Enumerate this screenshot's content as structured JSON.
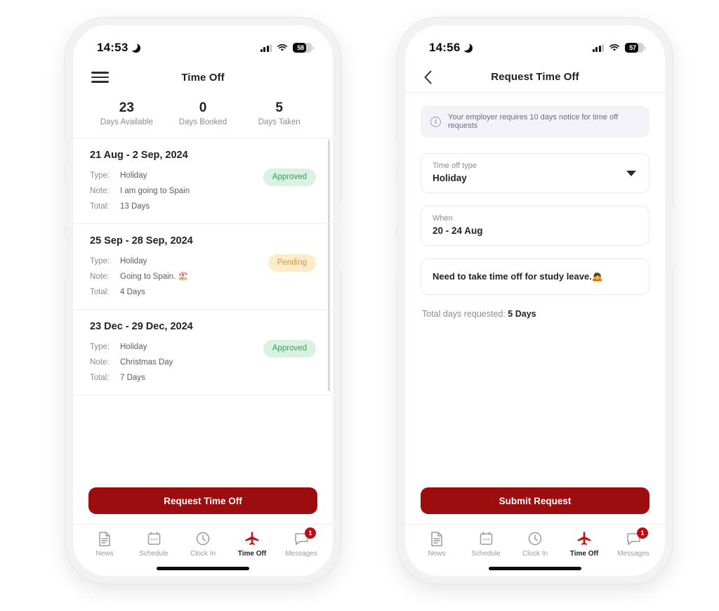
{
  "phones": [
    {
      "id": "time-off-list",
      "status_bar": {
        "time": "14:53",
        "moon_icon": "crescent-moon-icon",
        "signal_icon": "cellular-bars-icon",
        "wifi_icon": "wifi-icon",
        "battery_percent": "58"
      },
      "header": {
        "menu_icon": "hamburger-menu-icon",
        "title": "Time Off"
      },
      "summary": [
        {
          "value": "23",
          "label": "Days Available"
        },
        {
          "value": "0",
          "label": "Days Booked"
        },
        {
          "value": "5",
          "label": "Days Taken"
        }
      ],
      "requests": [
        {
          "dates": "21 Aug - 2 Sep, 2024",
          "type_key": "Type:",
          "type_value": "Holiday",
          "note_key": "Note:",
          "note_value": "I am going to Spain",
          "total_key": "Total:",
          "total_value": "13 Days",
          "status": "Approved",
          "status_kind": "approved"
        },
        {
          "dates": "25 Sep - 28 Sep, 2024",
          "type_key": "Type:",
          "type_value": "Holiday",
          "note_key": "Note:",
          "note_value": "Going to Spain. 🏖️",
          "total_key": "Total:",
          "total_value": "4 Days",
          "status": "Pending",
          "status_kind": "pending"
        },
        {
          "dates": "23 Dec - 29 Dec, 2024",
          "type_key": "Type:",
          "type_value": "Holiday",
          "note_key": "Note:",
          "note_value": "Christmas Day",
          "total_key": "Total:",
          "total_value": "7 Days",
          "status": "Approved",
          "status_kind": "approved"
        }
      ],
      "cta": "Request Time Off"
    },
    {
      "id": "request-time-off-form",
      "status_bar": {
        "time": "14:56",
        "moon_icon": "crescent-moon-icon",
        "signal_icon": "cellular-bars-icon",
        "wifi_icon": "wifi-icon",
        "battery_percent": "57"
      },
      "header": {
        "back_icon": "chevron-left-icon",
        "title": "Request Time Off"
      },
      "info_banner": {
        "icon": "info-circle-icon",
        "text": "Your employer requires 10 days notice for time off requests"
      },
      "fields": [
        {
          "label": "Time off type",
          "value": "Holiday",
          "control": "dropdown",
          "caret_icon": "caret-down-icon"
        },
        {
          "label": "When",
          "value": "20 - 24 Aug",
          "control": "date-range"
        }
      ],
      "note": "Need to take time off for study leave.🙇",
      "total_label": "Total days requested: ",
      "total_value": "5 Days",
      "cta": "Submit Request"
    }
  ],
  "tabbar": {
    "items": [
      {
        "label": "News",
        "icon": "document-icon",
        "active": false
      },
      {
        "label": "Schedule",
        "icon": "calendar-icon",
        "active": false
      },
      {
        "label": "Clock In",
        "icon": "clock-icon",
        "active": false
      },
      {
        "label": "Time Off",
        "icon": "airplane-icon",
        "active": true
      },
      {
        "label": "Messages",
        "icon": "chat-bubble-icon",
        "active": false,
        "badge": "1"
      }
    ]
  },
  "colors": {
    "brand_red": "#9c0d10",
    "badge_red": "#c00b12",
    "approved_bg": "#d9f2e1",
    "approved_text": "#3f9a62",
    "pending_bg": "#fcecc9",
    "pending_text": "#cc9a3f",
    "info_bg": "#f4f2f9"
  }
}
